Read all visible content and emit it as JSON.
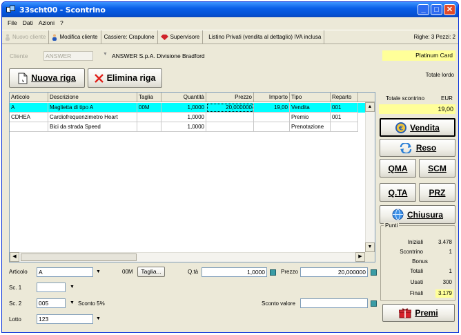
{
  "window": {
    "title": "33scht00 - Scontrino"
  },
  "window_controls": {
    "minimize": "_",
    "maximize": "□",
    "close": "✕"
  },
  "menu": [
    "File",
    "Dati",
    "Azioni",
    "?"
  ],
  "toolbar": {
    "nuovo_cliente": "Nuovo cliente",
    "modifica_cliente": "Modifica cliente",
    "cassiere": "Cassiere: Crapulone",
    "supervisore": "Supervisore",
    "listino": "Listino Privati (vendita al dettaglio) IVA inclusa",
    "righe": "Righe: 3  Pezzi: 2"
  },
  "cliente": {
    "label": "Cliente",
    "code": "ANSWER",
    "name": "ANSWER S.p.A. Divisione Bradford",
    "card": "Platinum Card"
  },
  "totale_label": "Totale lordo",
  "buttons": {
    "nuova_riga": "Nuova riga",
    "elimina_riga": "Elimina riga"
  },
  "grid": {
    "columns": [
      "Articolo",
      "Descrizione",
      "Taglia",
      "Quantità",
      "Prezzo",
      "Importo",
      "Tipo",
      "Reparto"
    ],
    "rows": [
      {
        "articolo": "A",
        "descrizione": "Maglietta di tipo A",
        "taglia": "00M",
        "quantita": "1,0000",
        "prezzo": "20,000000",
        "importo": "19,00",
        "tipo": "Vendita",
        "reparto": "001"
      },
      {
        "articolo": "CDHEA",
        "descrizione": "Cardiofrequenzimetro Heart",
        "taglia": "",
        "quantita": "1,0000",
        "prezzo": "",
        "importo": "",
        "tipo": "Premio",
        "reparto": "001"
      },
      {
        "articolo": "",
        "descrizione": "Bici da strada Speed",
        "taglia": "",
        "quantita": "1,0000",
        "prezzo": "",
        "importo": "",
        "tipo": "Prenotazione",
        "reparto": ""
      }
    ]
  },
  "fields": {
    "articolo_label": "Articolo",
    "articolo_value": "A",
    "taglia_code": "00M",
    "taglia_button": "Taglia...",
    "qta_label": "Q.tà",
    "qta_value": "1,0000",
    "prezzo_label": "Prezzo",
    "prezzo_value": "20,000000",
    "sc1_label": "Sc. 1",
    "sc1_value": "",
    "sc2_label": "Sc. 2",
    "sc2_value": "005",
    "sconto_desc": "Sconto 5%",
    "sconto_valore_label": "Sconto valore",
    "sconto_valore_value": "",
    "lotto_label": "Lotto",
    "lotto_value": "123"
  },
  "right_panel": {
    "totale_scontrino_label": "Totale scontrino",
    "currency": "EUR",
    "totale_scontrino": "19,00",
    "vendita": "Vendita",
    "reso": "Reso",
    "qma": "QMA",
    "scm": "SCM",
    "qta": "Q.TA",
    "prz": "PRZ",
    "chiusura": "Chiusura",
    "premi": "Premi"
  },
  "punti": {
    "title": "Punti",
    "iniziali_label": "Iniziali",
    "iniziali": "3.478",
    "scontrino_label": "Scontrino",
    "scontrino": "1",
    "bonus_label": "Bonus",
    "totali_label": "Totali",
    "totali": "1",
    "usati_label": "Usati",
    "usati": "300",
    "finali_label": "Finali",
    "finali": "3.179"
  },
  "colors": {
    "selection_row": "#00ffff",
    "highlight": "#ffff99",
    "titlebar": "#0553d5"
  }
}
